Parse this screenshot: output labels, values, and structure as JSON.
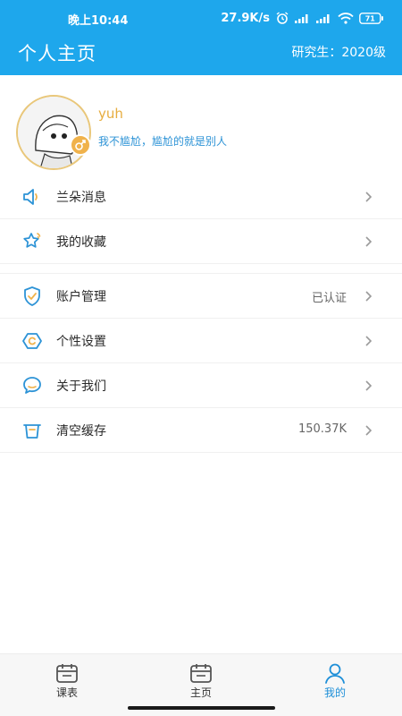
{
  "status_bar": {
    "time": "晚上10:44",
    "speed": "27.9K/s",
    "battery": "71"
  },
  "header": {
    "title": "个人主页",
    "subtitle": "研究生：2020级"
  },
  "profile": {
    "username": "yuh",
    "signature": "我不尴尬，尴尬的就是别人"
  },
  "menu_group_1": [
    {
      "label": "兰朵消息",
      "value": "",
      "icon": "speaker-icon"
    },
    {
      "label": "我的收藏",
      "value": "",
      "icon": "star-icon"
    }
  ],
  "menu_group_2": [
    {
      "label": "账户管理",
      "value": "已认证",
      "icon": "shield-check-icon"
    },
    {
      "label": "个性设置",
      "value": "",
      "icon": "hexagon-settings-icon"
    },
    {
      "label": "关于我们",
      "value": "",
      "icon": "chat-bubble-icon"
    },
    {
      "label": "清空缓存",
      "value": "150.37K",
      "icon": "trash-icon"
    }
  ],
  "tabs": [
    {
      "label": "课表",
      "icon": "calendar-icon"
    },
    {
      "label": "主页",
      "icon": "calendar-home-icon"
    },
    {
      "label": "我的",
      "icon": "person-icon",
      "active": true
    }
  ],
  "colors": {
    "primary": "#1ea7ec",
    "accent": "#e7ad3f",
    "link": "#2d93d6"
  }
}
